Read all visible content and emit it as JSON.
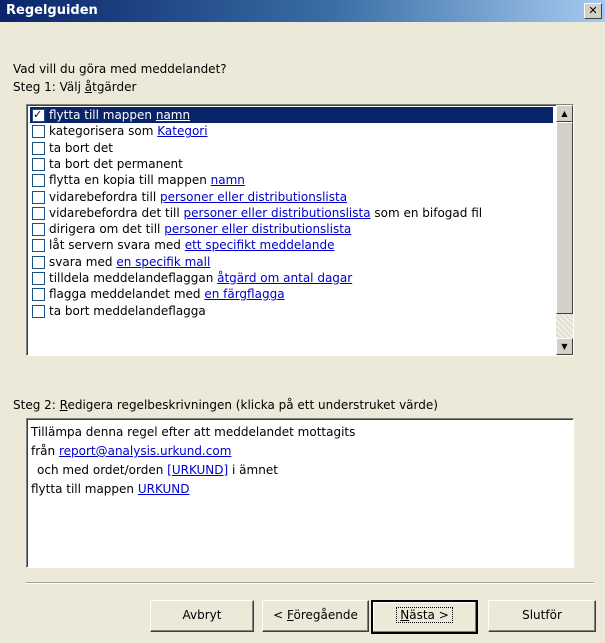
{
  "window": {
    "title": "Regelguiden",
    "close": "✕"
  },
  "prompt": "Vad vill du göra med meddelandet?",
  "step1": {
    "prefix": "Steg 1: Välj ",
    "hot": "å",
    "rest": "tgärder"
  },
  "actions": [
    {
      "pre": "flytta till mappen ",
      "link": "namn",
      "post": "",
      "checked": true,
      "selected": true
    },
    {
      "pre": "kategorisera som ",
      "link": "Kategori",
      "post": "",
      "checked": false
    },
    {
      "pre": "ta bort det",
      "link": "",
      "post": "",
      "checked": false
    },
    {
      "pre": "ta bort det permanent",
      "link": "",
      "post": "",
      "checked": false
    },
    {
      "pre": "flytta en kopia till mappen ",
      "link": "namn",
      "post": "",
      "checked": false
    },
    {
      "pre": "vidarebefordra till ",
      "link": "personer eller distributionslista",
      "post": "",
      "checked": false
    },
    {
      "pre": "vidarebefordra det till ",
      "link": "personer eller distributionslista",
      "post": " som en bifogad fil",
      "checked": false
    },
    {
      "pre": "dirigera om det till ",
      "link": "personer eller distributionslista",
      "post": "",
      "checked": false
    },
    {
      "pre": "låt servern svara med ",
      "link": "ett specifikt meddelande",
      "post": "",
      "checked": false
    },
    {
      "pre": "svara med ",
      "link": "en specifik mall",
      "post": "",
      "checked": false
    },
    {
      "pre": "tilldela meddelandeflaggan ",
      "link": "åtgärd om antal dagar",
      "post": "",
      "checked": false
    },
    {
      "pre": "flagga meddelandet med ",
      "link": "en färgflagga",
      "post": "",
      "checked": false
    },
    {
      "pre": "ta bort meddelandeflagga",
      "link": "",
      "post": "",
      "checked": false
    }
  ],
  "scroll": {
    "up": "▲",
    "down": "▼"
  },
  "step2": {
    "prefix": "Steg 2: ",
    "hot": "R",
    "rest": "edigera regelbeskrivningen (klicka på ett understruket värde)"
  },
  "description": {
    "line1": "Tillämpa denna regel efter att meddelandet mottagits",
    "from_pre": "från ",
    "from_link": "report@analysis.urkund.com",
    "word_pre": "och med ordet/orden ",
    "word_link": "[URKUND]",
    "word_post": " i ämnet",
    "move_pre": "flytta till mappen ",
    "move_link": "URKUND"
  },
  "buttons": {
    "cancel": "Avbryt",
    "back_pre": "< ",
    "back_hot": "F",
    "back_rest": "öregående",
    "next_hot": "N",
    "next_rest": "ästa >",
    "finish": "Slutför"
  }
}
